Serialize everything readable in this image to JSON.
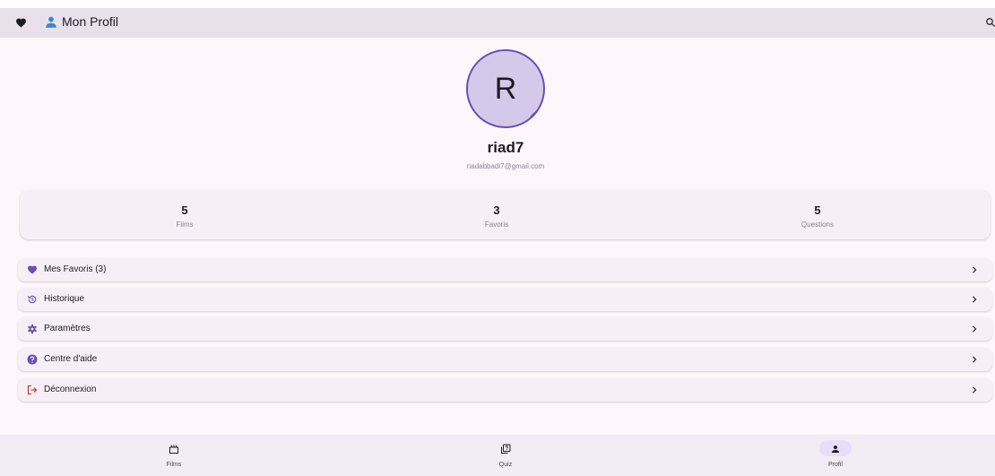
{
  "app_bar": {
    "title": "Mon Profil"
  },
  "profile": {
    "initial": "R",
    "username": "riad7",
    "email": "riadabbadi7@gmail.com"
  },
  "stats": [
    {
      "value": "5",
      "label": "Films"
    },
    {
      "value": "3",
      "label": "Favoris"
    },
    {
      "value": "5",
      "label": "Questions"
    }
  ],
  "menu": [
    {
      "label": "Mes Favoris (3)",
      "icon": "heart-icon"
    },
    {
      "label": "Historique",
      "icon": "history-icon"
    },
    {
      "label": "Paramètres",
      "icon": "gear-icon"
    },
    {
      "label": "Centre d'aide",
      "icon": "help-icon"
    },
    {
      "label": "Déconnexion",
      "icon": "logout-icon"
    }
  ],
  "bottom_nav": {
    "items": [
      {
        "label": "Films",
        "icon": "clapperboard-icon"
      },
      {
        "label": "Quiz",
        "icon": "quiz-icon"
      },
      {
        "label": "Profil",
        "icon": "person-icon",
        "selected": true
      }
    ]
  },
  "colors": {
    "accent": "#6a4fb5",
    "logout": "#c62828",
    "app_bar": "#e8e1ec",
    "background": "#fdf7fc"
  }
}
